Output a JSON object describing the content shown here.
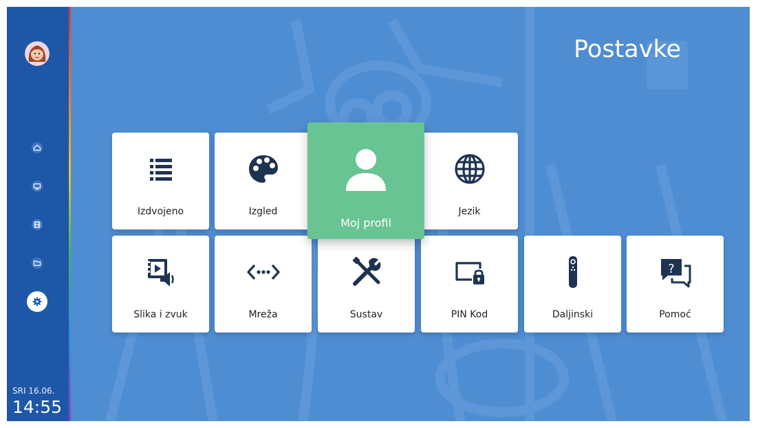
{
  "page": {
    "title": "Postavke"
  },
  "sidebar": {
    "date": "SRI 16.06.",
    "time": "14:55",
    "nav": [
      {
        "name": "home-icon"
      },
      {
        "name": "tv-icon"
      },
      {
        "name": "film-icon"
      },
      {
        "name": "folder-icon"
      },
      {
        "name": "gear-icon",
        "active": true
      }
    ]
  },
  "tiles": [
    {
      "label": "Izdvojeno",
      "icon": "list-icon"
    },
    {
      "label": "Izgled",
      "icon": "palette-icon"
    },
    {
      "label": "Moj profil",
      "icon": "user-icon",
      "focused": true
    },
    {
      "label": "Jezik",
      "icon": "globe-icon"
    },
    {
      "label": "Slika i zvuk",
      "icon": "video-audio-icon"
    },
    {
      "label": "Mreža",
      "icon": "network-icon"
    },
    {
      "label": "Sustav",
      "icon": "tools-icon"
    },
    {
      "label": "PIN Kod",
      "icon": "pin-lock-icon"
    },
    {
      "label": "Daljinski",
      "icon": "remote-icon"
    },
    {
      "label": "Pomoć",
      "icon": "help-icon"
    }
  ],
  "colors": {
    "background": "#4f8dd3",
    "sidebar": "#1f57a8",
    "focus": "#69c493",
    "icon": "#1e3350"
  }
}
